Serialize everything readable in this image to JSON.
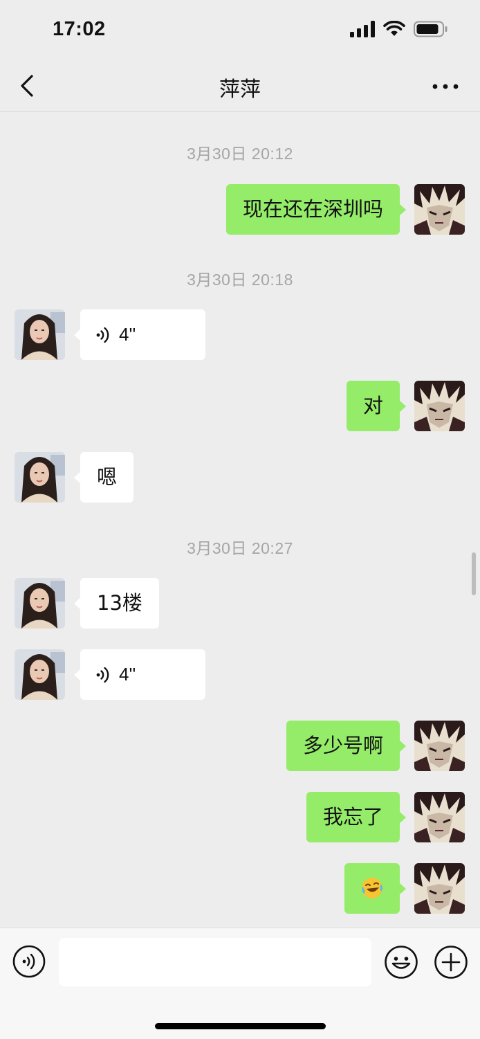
{
  "status_bar": {
    "time": "17:02"
  },
  "header": {
    "title": "萍萍",
    "back_icon": "chevron-left-icon",
    "more_icon": "more-dots-icon"
  },
  "messages": [
    {
      "type": "timestamp",
      "text": "3月30日 20:12"
    },
    {
      "type": "text",
      "side": "right",
      "text": "现在还在深圳吗"
    },
    {
      "type": "timestamp",
      "text": "3月30日 20:18"
    },
    {
      "type": "voice",
      "side": "left",
      "duration": "4''"
    },
    {
      "type": "text",
      "side": "right",
      "text": "对"
    },
    {
      "type": "text",
      "side": "left",
      "text": "嗯"
    },
    {
      "type": "timestamp",
      "text": "3月30日 20:27"
    },
    {
      "type": "text",
      "side": "left",
      "text": "13楼"
    },
    {
      "type": "voice",
      "side": "left",
      "duration": "4''"
    },
    {
      "type": "text",
      "side": "right",
      "text": "多少号啊"
    },
    {
      "type": "text",
      "side": "right",
      "text": "我忘了"
    },
    {
      "type": "emoji",
      "side": "right",
      "emoji": "😂"
    }
  ],
  "input_bar": {
    "placeholder": "",
    "voice_icon": "voice-mode-icon",
    "emoji_icon": "emoji-icon",
    "plus_icon": "plus-icon"
  },
  "colors": {
    "background": "#ededed",
    "sent_bubble": "#95ec69",
    "received_bubble": "#ffffff",
    "timestamp": "#a5a5a5"
  }
}
